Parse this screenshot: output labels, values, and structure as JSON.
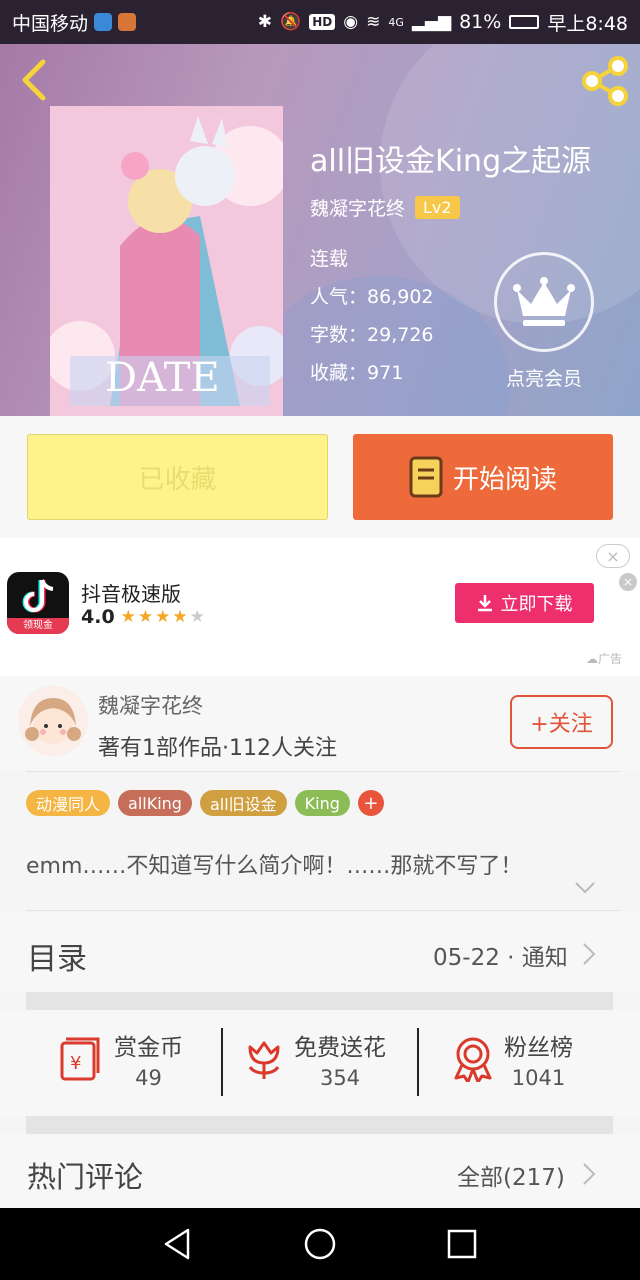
{
  "status_bar": {
    "carrier": "中国移动",
    "battery": "81%",
    "time": "早上8:48",
    "network": "4G",
    "hd": "HD"
  },
  "header": {
    "title": "all旧设金King之起源",
    "author": "魏凝字花终",
    "level": "Lv2",
    "status": "连载",
    "popularity_label": "人气：",
    "popularity": "86,902",
    "words_label": "字数：",
    "words": "29,726",
    "favorites_label": "收藏：",
    "favorites": "971",
    "vip_label": "点亮会员",
    "cover_text": "DATE"
  },
  "actions": {
    "collected_label": "已收藏",
    "read_label": "开始阅读"
  },
  "ad": {
    "app_name": "抖音极速版",
    "rating": "4.0",
    "stars_filled": 4,
    "stars_total": 5,
    "download_label": "立即下载",
    "icon_badge": "领现金",
    "ad_tag": "广告",
    "close_glyph": "×"
  },
  "author_card": {
    "name": "魏凝字花终",
    "stats": "著有1部作品·112人关注",
    "follow_label": "+关注"
  },
  "tags": [
    {
      "label": "动漫同人",
      "color": "#f5b544"
    },
    {
      "label": "allKing",
      "color": "#c66e5a"
    },
    {
      "label": "all旧设金",
      "color": "#d0a040"
    },
    {
      "label": "King",
      "color": "#8cbc56"
    }
  ],
  "tag_more": "+",
  "intro": "emm……不知道写什么简介啊！……那就不写了！",
  "catalog": {
    "label": "目录",
    "update": "05-22 · 通知"
  },
  "gifts": [
    {
      "name": "赏金币",
      "value": "49",
      "icon": "red-envelope-icon"
    },
    {
      "name": "免费送花",
      "value": "354",
      "icon": "flower-icon"
    },
    {
      "name": "粉丝榜",
      "value": "1041",
      "icon": "medal-icon"
    }
  ],
  "hot_comments": {
    "label": "热门评论",
    "all_label": "全部(217)"
  },
  "colors": {
    "accent_orange": "#ef6a3a",
    "collected_yellow": "#fdf38a",
    "icon_red": "#d93a2b",
    "download_pink": "#ee2f6e"
  }
}
